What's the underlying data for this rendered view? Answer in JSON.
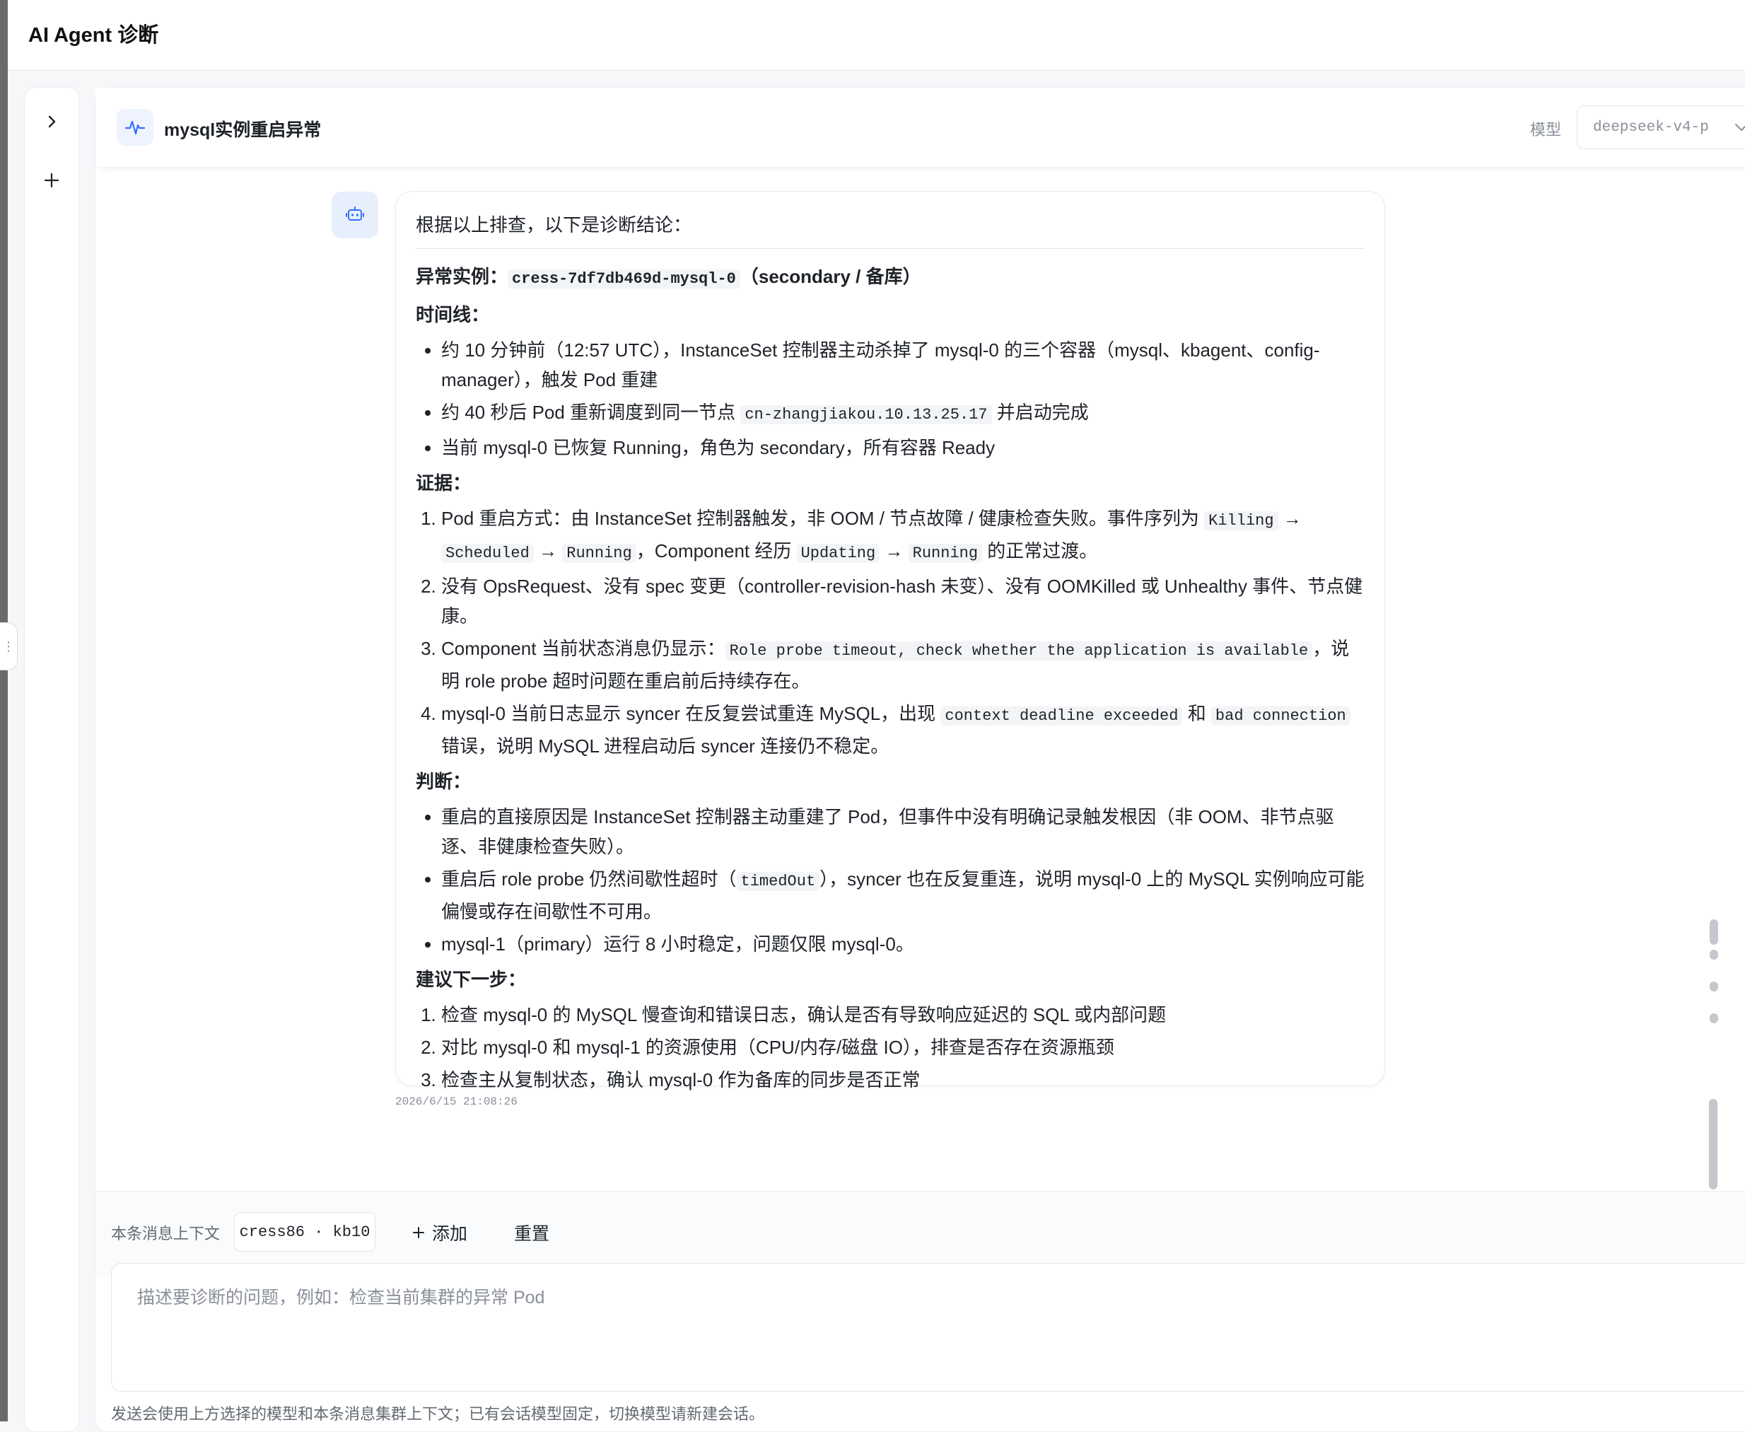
{
  "app": {
    "title": "AI Agent 诊断"
  },
  "session": {
    "title": "mysql实例重启异常"
  },
  "model": {
    "label": "模型",
    "selected": "deepseek-v4-p"
  },
  "message": {
    "intro": "根据以上排查，以下是诊断结论：",
    "instance_label": "异常实例：",
    "instance_code": "cress-7df7db469d-mysql-0",
    "instance_note": "（secondary / 备库）",
    "timeline_heading": "时间线：",
    "timeline_1": "约 10 分钟前（12:57 UTC），InstanceSet 控制器主动杀掉了 mysql-0 的三个容器（mysql、kbagent、config-manager），触发 Pod 重建",
    "timeline_2a": "约 40 秒后 Pod 重新调度到同一节点 ",
    "timeline_2code": "cn-zhangjiakou.10.13.25.17",
    "timeline_2b": " 并启动完成",
    "timeline_3": "当前 mysql-0 已恢复 Running，角色为 secondary，所有容器 Ready",
    "evidence_heading": "证据：",
    "ev1_a": "Pod 重启方式：由 InstanceSet 控制器触发，非 OOM / 节点故障 / 健康检查失败。事件序列为 ",
    "ev1_c1": "Killing",
    "ev1_arrow1": " → ",
    "ev1_c2": "Scheduled",
    "ev1_arrow2": " → ",
    "ev1_c3": "Running",
    "ev1_b": "，Component 经历 ",
    "ev1_c4": "Updating",
    "ev1_arrow3": " → ",
    "ev1_c5": "Running",
    "ev1_end": " 的正常过渡。",
    "ev2": "没有 OpsRequest、没有 spec 变更（controller-revision-hash 未变）、没有 OOMKilled 或 Unhealthy 事件、节点健康。",
    "ev3_a": "Component 当前状态消息仍显示：",
    "ev3_code": "Role probe timeout, check whether the application is available",
    "ev3_b": "，说明 role probe 超时问题在重启前后持续存在。",
    "ev4_a": "mysql-0 当前日志显示 syncer 在反复尝试重连 MySQL，出现 ",
    "ev4_c1": "context deadline exceeded",
    "ev4_mid": " 和 ",
    "ev4_c2": "bad connection",
    "ev4_b": " 错误，说明 MySQL 进程启动后 syncer 连接仍不稳定。",
    "judgment_heading": "判断：",
    "j1": "重启的直接原因是 InstanceSet 控制器主动重建了 Pod，但事件中没有明确记录触发根因（非 OOM、非节点驱逐、非健康检查失败）。",
    "j2_a": "重启后 role probe 仍然间歇性超时（",
    "j2_code": "timedOut",
    "j2_b": "），syncer 也在反复重连，说明 mysql-0 上的 MySQL 实例响应可能偏慢或存在间歇性不可用。",
    "j3": "mysql-1（primary）运行 8 小时稳定，问题仅限 mysql-0。",
    "next_heading": "建议下一步：",
    "n1": "检查 mysql-0 的 MySQL 慢查询和错误日志，确认是否有导致响应延迟的 SQL 或内部问题",
    "n2": "对比 mysql-0 和 mysql-1 的资源使用（CPU/内存/磁盘 IO），排查是否存在资源瓶颈",
    "n3": "检查主从复制状态，确认 mysql-0 作为备库的同步是否正常",
    "timestamp": "2026/6/15 21:08:26"
  },
  "context": {
    "label": "本条消息上下文",
    "chip": "cress86 · kb10",
    "add_label": "添加",
    "reset_label": "重置"
  },
  "composer": {
    "placeholder": "描述要诊断的问题，例如：检查当前集群的异常 Pod",
    "hint": "发送会使用上方选择的模型和本条消息集群上下文；已有会话模型固定，切换模型请新建会话。"
  },
  "colors": {
    "accent": "#3370ff",
    "avatar_bg": "#e8effc",
    "text": "#1f2329",
    "muted": "#8a8f99"
  },
  "icons": [
    "expand-chevron-icon",
    "plus-icon",
    "pulse-icon",
    "robot-icon",
    "chevron-down-icon",
    "drag-handle-icon"
  ]
}
